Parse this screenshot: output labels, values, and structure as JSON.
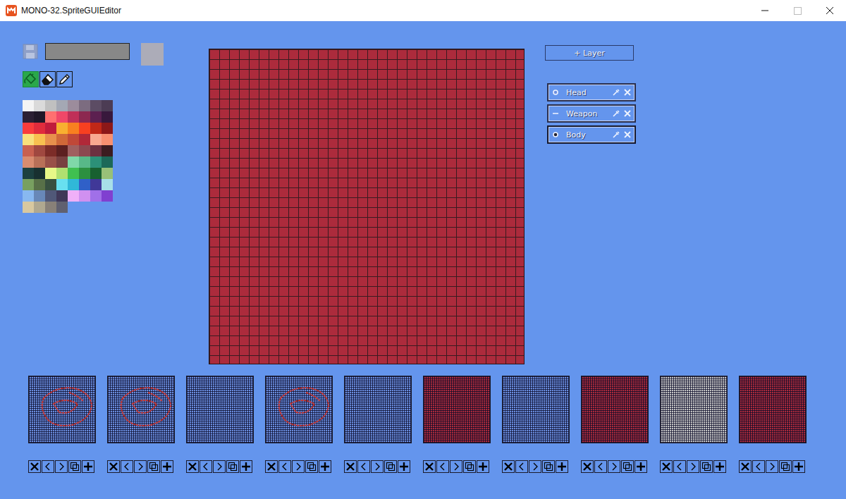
{
  "window": {
    "title": "MONO-32.SpriteGUIEditor"
  },
  "current_color": "#acacb8",
  "tools": [
    {
      "kind": "fill",
      "selected": true
    },
    {
      "kind": "eraser",
      "selected": false
    },
    {
      "kind": "pencil",
      "selected": false
    }
  ],
  "palette": [
    "#f4f4f4",
    "#dadada",
    "#c0c0c0",
    "#a4a8b4",
    "#9c8c9c",
    "#7c6c80",
    "#5c4c64",
    "#4c3c54",
    "#2c2034",
    "#201828",
    "#ff7070",
    "#f04868",
    "#c03058",
    "#8c2850",
    "#5c2050",
    "#38183c",
    "#f83c3c",
    "#e02c3c",
    "#c01c3c",
    "#f8b030",
    "#f88020",
    "#f84020",
    "#c02818",
    "#8c1818",
    "#f8e07c",
    "#f8c050",
    "#e8904c",
    "#d06838",
    "#c04838",
    "#b02838",
    "#f8a890",
    "#f89070",
    "#c86050",
    "#a04840",
    "#7c2c28",
    "#5c2020",
    "#a06060",
    "#8c4850",
    "#6c3040",
    "#3c1c20",
    "#d88c70",
    "#b87058",
    "#985048",
    "#784040",
    "#80d8a8",
    "#58b888",
    "#2c9078",
    "#1c6858",
    "#1c4040",
    "#183030",
    "#e8f888",
    "#b0e070",
    "#40c050",
    "#2c9040",
    "#186030",
    "#98c078",
    "#78a060",
    "#587048",
    "#385040",
    "#68e0f0",
    "#30b8d8",
    "#3060c8",
    "#403898",
    "#a8e0e8",
    "#88b8f0",
    "#6888b8",
    "#505878",
    "#403858",
    "#f0b0f8",
    "#d090f0",
    "#a070e8",
    "#8040d0",
    "#d8c8a0",
    "#b0a890",
    "#888078",
    "#606070"
  ],
  "add_layer_button": "+ Layer",
  "layers": [
    {
      "name": "Head",
      "visible": true,
      "selected": false
    },
    {
      "name": "Weapon",
      "visible": false,
      "selected": false
    },
    {
      "name": "Body",
      "visible": true,
      "selected": true
    }
  ],
  "frames": [
    {
      "fill": "#6b8ee0",
      "sketch": true
    },
    {
      "fill": "#6b8ee0",
      "sketch": true
    },
    {
      "fill": "#6b8ee0",
      "sketch": false
    },
    {
      "fill": "#6b8ee0",
      "sketch": true
    },
    {
      "fill": "#6b8ee0",
      "sketch": false
    },
    {
      "fill": "#ac2b3c",
      "sketch": false
    },
    {
      "fill": "#6b8ee0",
      "sketch": false
    },
    {
      "fill": "#ac2b3c",
      "sketch": false
    },
    {
      "fill": "#c4c4c4",
      "sketch": false
    },
    {
      "fill": "#ac2b3c",
      "sketch": false
    }
  ]
}
